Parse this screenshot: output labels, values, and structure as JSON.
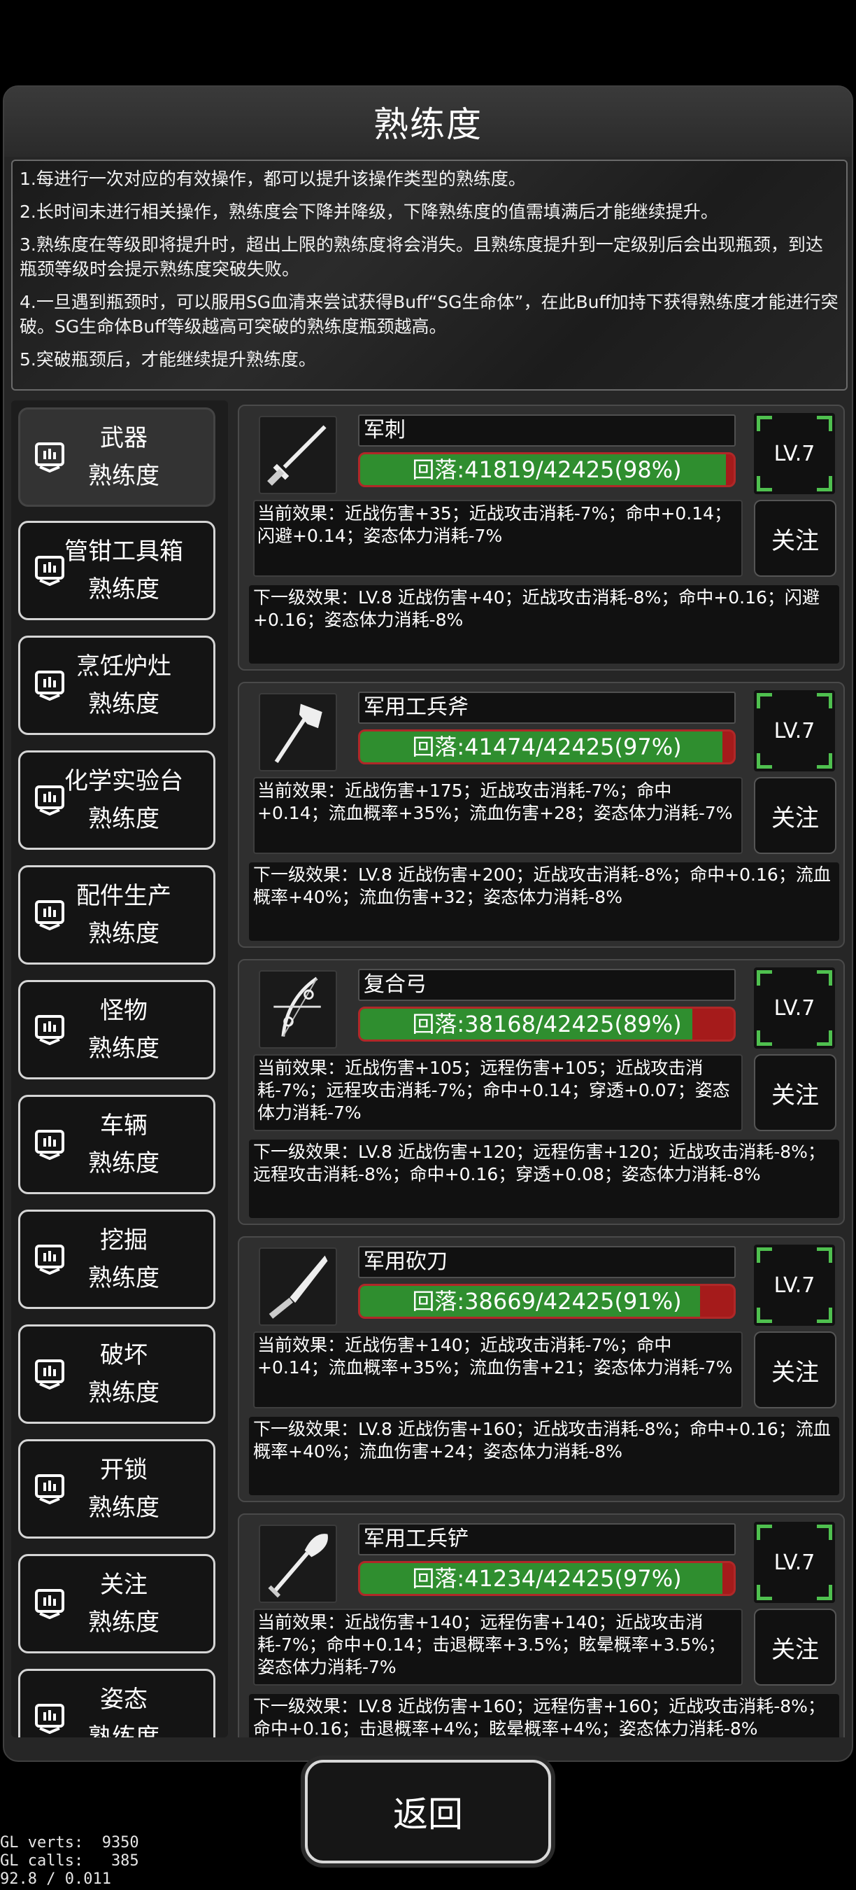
{
  "title": "熟练度",
  "rules": [
    "1.每进行一次对应的有效操作，都可以提升该操作类型的熟练度。",
    "2.长时间未进行相关操作，熟练度会下降并降级，下降熟练度的值需填满后才能继续提升。",
    "3.熟练度在等级即将提升时，超出上限的熟练度将会消失。且熟练度提升到一定级别后会出现瓶颈，到达瓶颈等级时会提示熟练度突破失败。",
    "4.一旦遇到瓶颈时，可以服用SG血清来尝试获得Buff“SG生命体”，在此Buff加持下获得熟练度才能进行突破。SG生命体Buff等级越高可突破的熟练度瓶颈越高。",
    "5.突破瓶颈后，才能继续提升熟练度。"
  ],
  "categories": [
    {
      "line1": "武器",
      "line2": "熟练度",
      "active": true
    },
    {
      "line1": "管钳工具箱",
      "line2": "熟练度"
    },
    {
      "line1": "烹饪炉灶",
      "line2": "熟练度"
    },
    {
      "line1": "化学实验台",
      "line2": "熟练度"
    },
    {
      "line1": "配件生产",
      "line2": "熟练度"
    },
    {
      "line1": "怪物",
      "line2": "熟练度"
    },
    {
      "line1": "车辆",
      "line2": "熟练度"
    },
    {
      "line1": "挖掘",
      "line2": "熟练度"
    },
    {
      "line1": "破坏",
      "line2": "熟练度"
    },
    {
      "line1": "开锁",
      "line2": "熟练度"
    },
    {
      "line1": "关注",
      "line2": "熟练度"
    },
    {
      "line1": "姿态",
      "line2": "熟练度"
    }
  ],
  "items": [
    {
      "name": "军刺",
      "icon": "bayonet-icon",
      "progress": "回落:41819/42425(98%)",
      "fill": 0.98,
      "level": "LV.7",
      "current": "当前效果：近战伤害+35；近战攻击消耗-7%；命中+0.14；闪避+0.14；姿态体力消耗-7%",
      "next": "下一级效果：LV.8 近战伤害+40；近战攻击消耗-8%；命中+0.16；闪避+0.16；姿态体力消耗-8%",
      "follow": "关注"
    },
    {
      "name": "军用工兵斧",
      "icon": "axe-icon",
      "progress": "回落:41474/42425(97%)",
      "fill": 0.97,
      "level": "LV.7",
      "current": "当前效果：近战伤害+175；近战攻击消耗-7%；命中+0.14；流血概率+35%；流血伤害+28；姿态体力消耗-7%",
      "next": "下一级效果：LV.8 近战伤害+200；近战攻击消耗-8%；命中+0.16；流血概率+40%；流血伤害+32；姿态体力消耗-8%",
      "follow": "关注"
    },
    {
      "name": "复合弓",
      "icon": "compound-bow-icon",
      "progress": "回落:38168/42425(89%)",
      "fill": 0.89,
      "level": "LV.7",
      "current": "当前效果：近战伤害+105；远程伤害+105；近战攻击消耗-7%；远程攻击消耗-7%；命中+0.14；穿透+0.07；姿态体力消耗-7%",
      "next": "下一级效果：LV.8 近战伤害+120；远程伤害+120；近战攻击消耗-8%；远程攻击消耗-8%；命中+0.16；穿透+0.08；姿态体力消耗-8%",
      "follow": "关注"
    },
    {
      "name": "军用砍刀",
      "icon": "machete-icon",
      "progress": "回落:38669/42425(91%)",
      "fill": 0.91,
      "level": "LV.7",
      "current": "当前效果：近战伤害+140；近战攻击消耗-7%；命中+0.14；流血概率+35%；流血伤害+21；姿态体力消耗-7%",
      "next": "下一级效果：LV.8 近战伤害+160；近战攻击消耗-8%；命中+0.16；流血概率+40%；流血伤害+24；姿态体力消耗-8%",
      "follow": "关注"
    },
    {
      "name": "军用工兵铲",
      "icon": "shovel-icon",
      "progress": "回落:41234/42425(97%)",
      "fill": 0.97,
      "level": "LV.7",
      "current": "当前效果：近战伤害+140；远程伤害+140；近战攻击消耗-7%；命中+0.14；击退概率+3.5%；眩晕概率+3.5%；姿态体力消耗-7%",
      "next": "下一级效果：LV.8 近战伤害+160；远程伤害+160；近战攻击消耗-8%；命中+0.16；击退概率+4%；眩晕概率+4%；姿态体力消耗-8%",
      "follow": "关注"
    }
  ],
  "back_label": "返回",
  "debug": {
    "verts": "GL verts:  9350",
    "calls": "GL calls:   385",
    "fps": "92.8 / 0.011"
  }
}
